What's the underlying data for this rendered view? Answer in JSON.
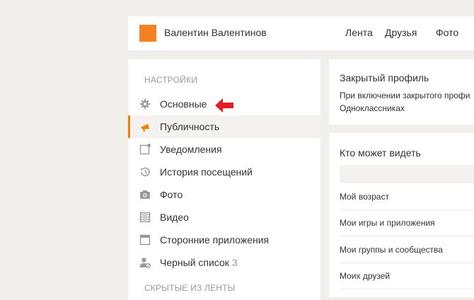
{
  "header": {
    "user_name": "Валентин Валентинов",
    "nav": [
      "Лента",
      "Друзья",
      "Фото"
    ],
    "avatar_color": "#f58220"
  },
  "sidebar": {
    "settings_title": "НАСТРОЙКИ",
    "items": [
      {
        "label": "Основные",
        "icon": "gear-icon"
      },
      {
        "label": "Публичность",
        "icon": "megaphone-icon",
        "active": true
      },
      {
        "label": "Уведомления",
        "icon": "notification-icon"
      },
      {
        "label": "История посещений",
        "icon": "history-icon"
      },
      {
        "label": "Фото",
        "icon": "camera-icon"
      },
      {
        "label": "Видео",
        "icon": "film-icon"
      },
      {
        "label": "Сторонние приложения",
        "icon": "window-icon"
      },
      {
        "label": "Черный список",
        "icon": "blocked-user-icon",
        "count": "3"
      }
    ],
    "hidden_title": "СКРЫТЫЕ ИЗ ЛЕНТЫ",
    "accent_color": "#ee8208"
  },
  "closed_profile": {
    "title": "Закрытый профиль",
    "desc_line1": "При включении закрытого профи",
    "desc_line2": "Одноклассниках"
  },
  "privacy": {
    "title": "Кто может видеть",
    "rows": [
      "Мой возраст",
      "Мои игры и приложения",
      "Мои группы и сообщества",
      "Моих друзей"
    ]
  },
  "annotation": {
    "arrow_color": "#e31e24",
    "arrow_icon": "red-arrow-icon"
  }
}
